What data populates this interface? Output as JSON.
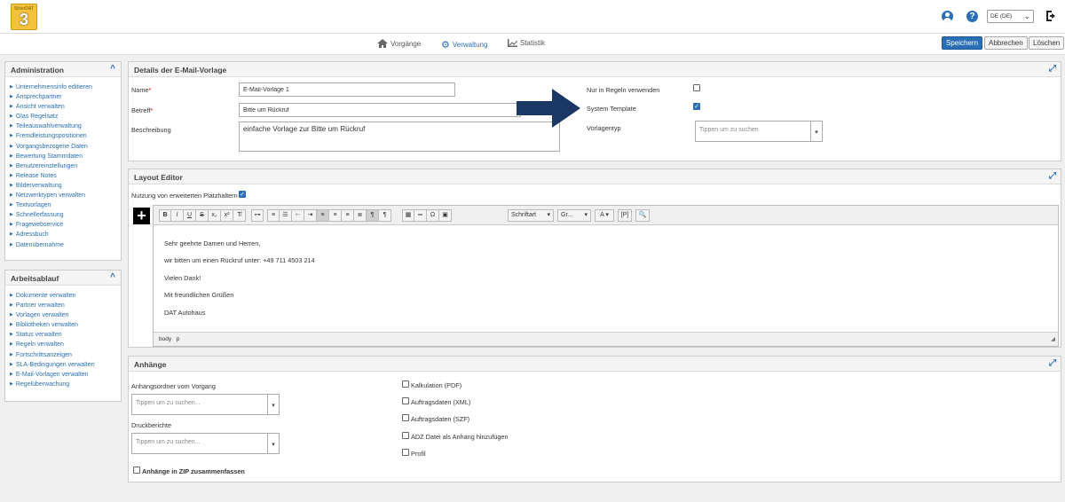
{
  "app": {
    "logo_text": "SilverDAT 3"
  },
  "header": {
    "language": "DE (DE)"
  },
  "nav": {
    "items": [
      {
        "label": "Vorgänge",
        "active": false,
        "icon": "home-icon"
      },
      {
        "label": "Verwaltung",
        "active": true,
        "icon": "gear-icon"
      },
      {
        "label": "Statistik",
        "active": false,
        "icon": "chart-icon"
      }
    ]
  },
  "actions": {
    "save": "Speichern",
    "cancel": "Abbrechen",
    "delete": "Löschen"
  },
  "sidebar": {
    "admin": {
      "title": "Administration",
      "items": [
        "Unternehmensinfo editieren",
        "Ansprechpartner",
        "Ansicht verwalten",
        "Glas Regelsatz",
        "Teileauswahlverwaltung",
        "Fremdleistungspositionen",
        "Vorgangsbezogene Daten",
        "Bewertung Stammdaten",
        "Benutzereinstellungen",
        "Release Notes",
        "Bilderverwaltung",
        "Netzwerktypen verwalten",
        "Textvorlagen",
        "Schnellerfassung",
        "Fragewebservice",
        "Adressbuch",
        "Datenübernahme"
      ]
    },
    "workflow": {
      "title": "Arbeitsablauf",
      "items": [
        "Dokumente verwalten",
        "Partner verwalten",
        "Vorlagen verwalten",
        "Bibliotheken verwalten",
        "Status verwalten",
        "Regeln verwalten",
        "Fortschrittsanzeigen",
        "SLA-Bedingungen verwalten",
        "E-Mail-Vorlagen verwalten",
        "Regelüberwachung"
      ]
    }
  },
  "details": {
    "title": "Details der E-Mail-Vorlage",
    "name_label": "Name",
    "name_value": "E-Mail-Vorlage 1",
    "subject_label": "Betreff",
    "subject_value": "Bitte um Rückruf",
    "desc_label": "Beschreibung",
    "desc_value": "einfache Vorlage zur Bitte um Rückruf",
    "rules_only_label": "Nur in Regeln verwenden",
    "rules_only_checked": false,
    "system_template_label": "System Template",
    "system_template_checked": true,
    "template_type_label": "Vorlagentyp",
    "template_type_placeholder": "Tippen um zu suchen"
  },
  "layout_editor": {
    "title": "Layout Editor",
    "ext_placeholders_label": "Nutzung von erweiterten Platzhaltern",
    "ext_placeholders_checked": true,
    "toolbar": {
      "font_label": "Schriftart",
      "size_label": "Gr..."
    },
    "content": [
      "Sehr geehrte Damen und Herren,",
      "wir bitten um einen Rückruf unter: +49 711 4503 214",
      "Vielen Dank!",
      "Mit freundlichen Grüßen",
      "DAT Autohaus"
    ],
    "status_path": [
      "body",
      "p"
    ]
  },
  "attachments": {
    "title": "Anhänge",
    "folder_label": "Anhangsordner vom Vorgang",
    "folder_placeholder": "Tippen um zu suchen...",
    "print_label": "Druckberichte",
    "print_placeholder": "Tippen um zu suchen...",
    "zip_label": "Anhänge in ZIP zusammenfassen",
    "options": [
      "Kalkulation (PDF)",
      "Auftragsdaten (XML)",
      "Auftragsdaten (SZF)",
      "ADZ Datei als Anhang hinzufügen",
      "Profil"
    ]
  },
  "colors": {
    "accent": "#2a6fb5",
    "arrow": "#1a3766"
  }
}
